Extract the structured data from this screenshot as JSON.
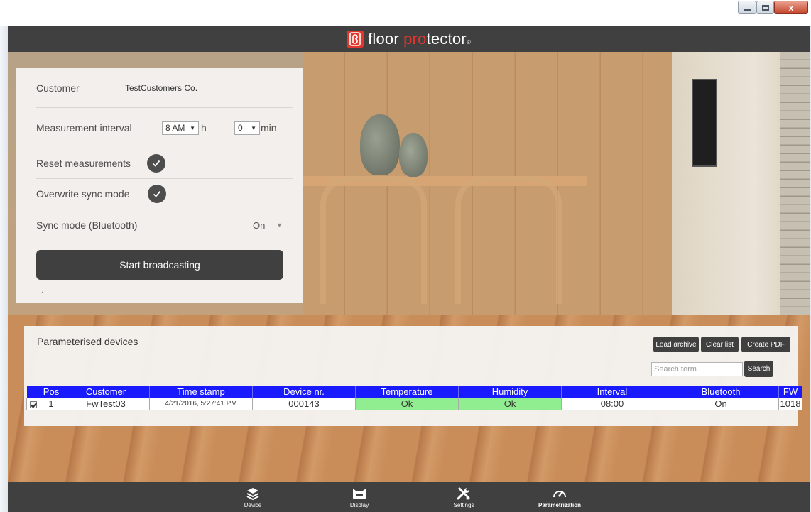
{
  "app": {
    "logo_word_1": "floor ",
    "logo_word_accent": "pro",
    "logo_word_2": "tector",
    "logo_reg": "®"
  },
  "colors": {
    "header_bg": "#404040",
    "brand_red": "#e3372d",
    "table_header_bg": "#1a1aff",
    "status_ok_bg": "#90ee90"
  },
  "settings": {
    "customer_label": "Customer",
    "customer_value": "TestCustomers Co.",
    "interval_label": "Measurement interval",
    "interval_hours": "8 AM",
    "interval_hours_unit": "h",
    "interval_minutes": "0",
    "interval_minutes_unit": "min",
    "reset_label": "Reset measurements",
    "reset_checked": true,
    "overwrite_label": "Overwrite sync mode",
    "overwrite_checked": true,
    "sync_label": "Sync mode (Bluetooth)",
    "sync_value": "On",
    "start_button": "Start broadcasting",
    "status_text": "..."
  },
  "devices": {
    "title": "Parameterised devices",
    "load_archive": "Load archive",
    "clear_list": "Clear list",
    "create_pdf": "Create PDF",
    "search_placeholder": "Search term",
    "search_button": "Search",
    "columns": [
      "Pos",
      "Customer",
      "Time stamp",
      "Device nr.",
      "Temperature",
      "Humidity",
      "Interval",
      "Bluetooth",
      "FW"
    ],
    "rows": [
      {
        "selected": true,
        "pos": "1",
        "customer": "FwTest03",
        "timestamp": "4/21/2016, 5:27:41 PM",
        "device_nr": "000143",
        "temperature": "Ok",
        "humidity": "Ok",
        "interval": "08:00",
        "bluetooth": "On",
        "fw": "1018"
      }
    ]
  },
  "nav": {
    "items": [
      {
        "label": "Device",
        "icon": "layers-icon"
      },
      {
        "label": "Display",
        "icon": "display-icon"
      },
      {
        "label": "Settings",
        "icon": "tools-icon"
      },
      {
        "label": "Parametrization",
        "icon": "gauge-icon",
        "active": true
      }
    ]
  },
  "window": {
    "close_glyph": "x"
  }
}
